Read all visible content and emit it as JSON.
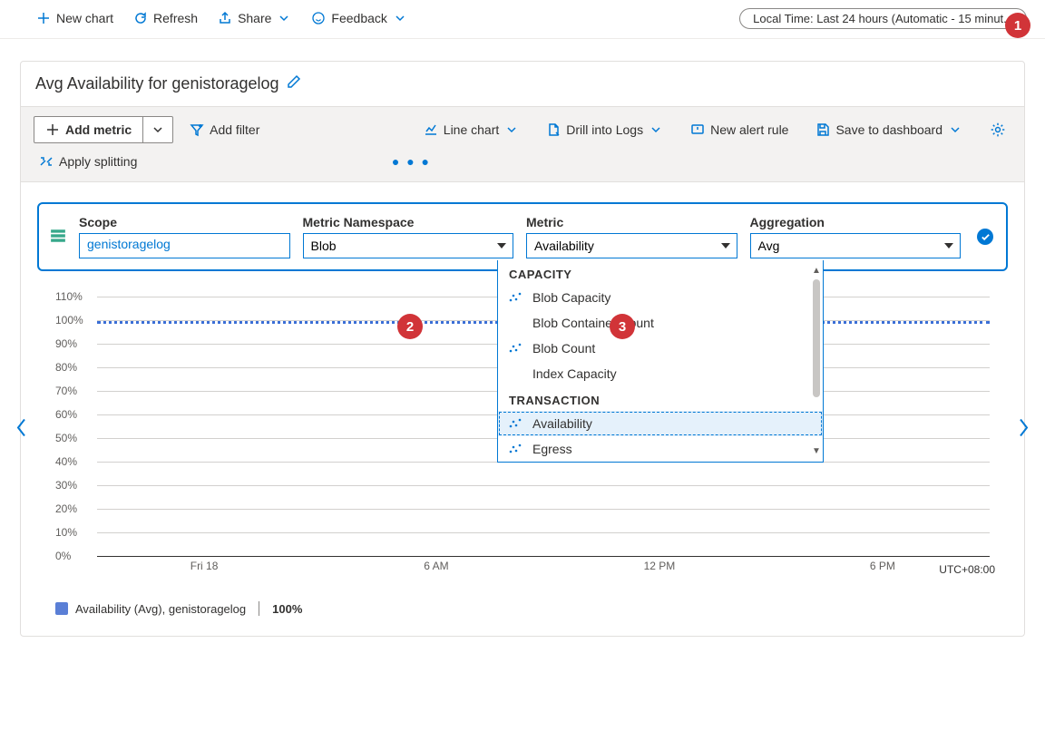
{
  "toolbar": {
    "new_chart": "New chart",
    "refresh": "Refresh",
    "share": "Share",
    "feedback": "Feedback",
    "time_range": "Local Time: Last 24 hours (Automatic - 15 minut..."
  },
  "card": {
    "title": "Avg Availability for genistoragelog",
    "add_metric": "Add metric",
    "add_filter": "Add filter",
    "apply_splitting": "Apply splitting",
    "line_chart": "Line chart",
    "drill_logs": "Drill into Logs",
    "new_alert": "New alert rule",
    "save_dashboard": "Save to dashboard"
  },
  "picker": {
    "scope_label": "Scope",
    "scope_value": "genistoragelog",
    "ns_label": "Metric Namespace",
    "ns_value": "Blob",
    "metric_label": "Metric",
    "metric_value": "Availability",
    "agg_label": "Aggregation",
    "agg_value": "Avg"
  },
  "dropdown": {
    "groups": [
      {
        "header": "CAPACITY",
        "items": [
          {
            "label": "Blob Capacity",
            "icon": true
          },
          {
            "label": "Blob Container Count",
            "icon": false
          },
          {
            "label": "Blob Count",
            "icon": true
          },
          {
            "label": "Index Capacity",
            "icon": false
          }
        ]
      },
      {
        "header": "TRANSACTION",
        "items": [
          {
            "label": "Availability",
            "icon": true,
            "selected": true
          },
          {
            "label": "Egress",
            "icon": true
          }
        ]
      }
    ]
  },
  "chart_data": {
    "type": "line",
    "title": "Avg Availability for genistoragelog",
    "ylabel": "",
    "ylim": [
      0,
      110
    ],
    "y_ticks": [
      "110%",
      "100%",
      "90%",
      "80%",
      "70%",
      "60%",
      "50%",
      "40%",
      "30%",
      "20%",
      "10%",
      "0%"
    ],
    "x_ticks": [
      "Fri 18",
      "6 AM",
      "12 PM",
      "6 PM"
    ],
    "tz": "UTC+08:00",
    "series": [
      {
        "name": "Availability (Avg), genistoragelog",
        "constant_value": 100,
        "display_value": "100%"
      }
    ]
  },
  "legend": {
    "text": "Availability (Avg), genistoragelog",
    "value": "100%"
  },
  "callouts": {
    "c1": "1",
    "c2": "2",
    "c3": "3"
  }
}
